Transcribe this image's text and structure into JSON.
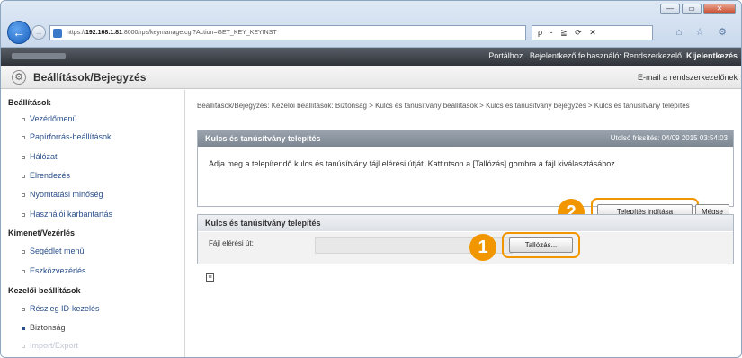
{
  "browser": {
    "url_prefix": "https://",
    "url_host": "192.168.1.81",
    "url_rest": ":8000/rps/keymanage.cgi?Action=GET_KEY_KEYINST",
    "address_tools": "ρ - ≧ ⟳ ✕",
    "nav_icons": "⌂ ☆ ⚙",
    "window_buttons": [
      "—",
      "▭",
      "✕"
    ]
  },
  "portal_bar": {
    "portal_link": "Portálhoz",
    "login_user": "Bejelentkező felhasználó: Rendszerkezelő",
    "logout": "Kijelentkezés"
  },
  "header": {
    "title": "Beállítások/Bejegyzés",
    "mail_link": "E-mail a rendszerkezelőnek"
  },
  "sidebar": {
    "sections": [
      {
        "title": "Beállítások",
        "items": [
          "Vezérlőmenü",
          "Papírforrás-beállítások",
          "Hálózat",
          "Elrendezés",
          "Nyomtatási minőség",
          "Használói karbantartás"
        ]
      },
      {
        "title": "Kimenet/Vezérlés",
        "items": [
          "Segédlet menü",
          "Eszközvezérlés"
        ]
      },
      {
        "title": "Kezelői beállítások",
        "items": [
          "Részleg ID-kezelés",
          "Biztonság",
          "Import/Export"
        ]
      }
    ]
  },
  "breadcrumb": "Beállítások/Bejegyzés: Kezelői beállítások: Biztonság > Kulcs és tanúsítvány beállítások > Kulcs és tanúsítvány bejegyzés > Kulcs és tanúsítvány telepítés",
  "install_panel": {
    "title": "Kulcs és tanúsítvány telepítés",
    "updated": "Utolsó frissítés: 04/09 2015 03:54:03",
    "instruction": "Adja meg a telepítendő kulcs és tanúsítvány fájl elérési útját. Kattintson a [Tallózás] gombra a fájl kiválasztásához.",
    "start_button": "Telepítés indítása",
    "cancel_button": "Mégse"
  },
  "file_panel": {
    "title": "Kulcs és tanúsítvány telepítés",
    "field_label": "Fájl elérési út:",
    "browse_button": "Tallózás..."
  },
  "callouts": {
    "step1": "1",
    "step2": "2",
    "color": "#f29600"
  }
}
